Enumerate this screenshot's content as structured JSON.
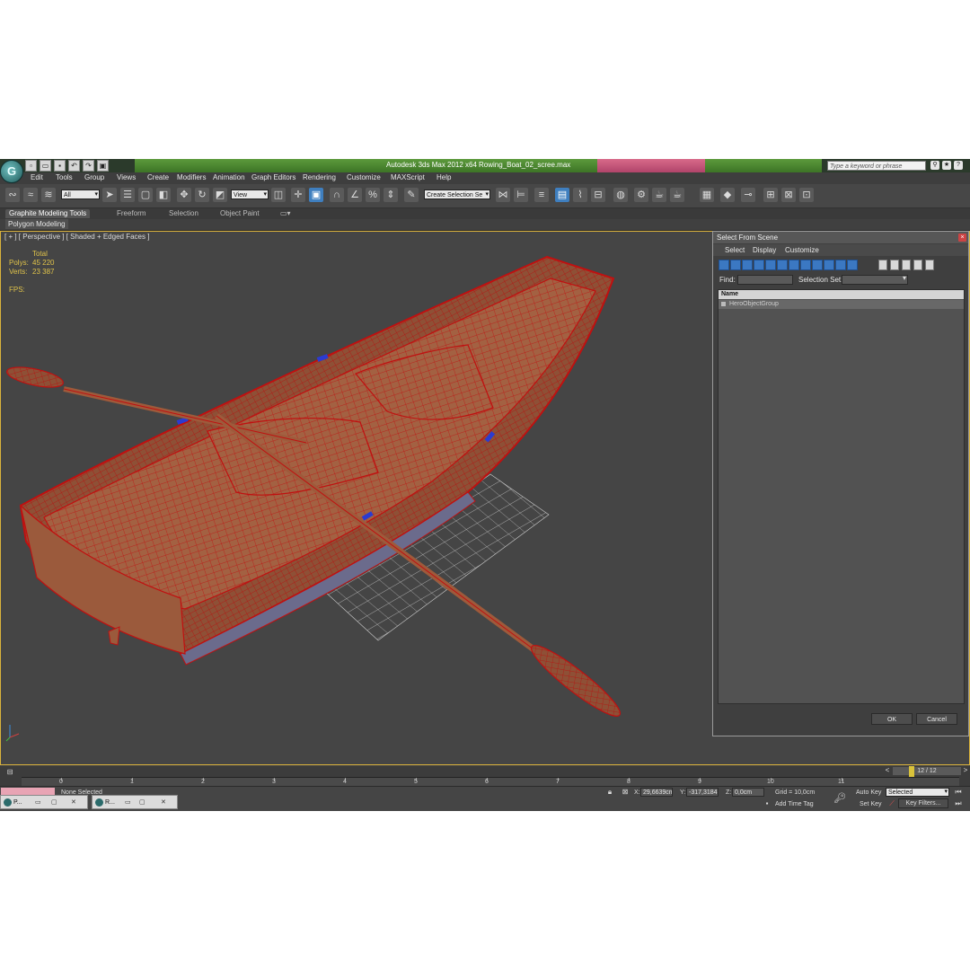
{
  "title": {
    "app": "Autodesk 3ds Max  2012 x64",
    "file": "Rowing_Boat_02_scree.max",
    "search_placeholder": "Type a keyword or phrase"
  },
  "menu": [
    "Edit",
    "Tools",
    "Group",
    "Views",
    "Create",
    "Modifiers",
    "Animation",
    "Graph Editors",
    "Rendering",
    "Customize",
    "MAXScript",
    "Help"
  ],
  "toolbar": {
    "selection_filter": "All",
    "reference_coord": "View",
    "named_selection": "Create Selection Se"
  },
  "ribbon": {
    "tabs": [
      "Graphite Modeling Tools",
      "Freeform",
      "Selection",
      "Object Paint"
    ],
    "panel_label": "Polygon Modeling"
  },
  "viewport": {
    "label": "[ + ] [ Perspective ] [ Shaded + Edged Faces ]",
    "stats_header": "Total",
    "polys_label": "Polys:",
    "polys_value": "45 220",
    "verts_label": "Verts:",
    "verts_value": "23 387",
    "fps_label": "FPS:"
  },
  "dialog": {
    "title": "Select From Scene",
    "menu": [
      "Select",
      "Display",
      "Customize"
    ],
    "find_label": "Find:",
    "selection_set_label": "Selection Set:",
    "column_name": "Name",
    "items": [
      "HeroObjectGroup"
    ],
    "ok": "OK",
    "cancel": "Cancel"
  },
  "timeline": {
    "frame_counter": "12 / 12",
    "ticks": [
      "0",
      "1",
      "2",
      "3",
      "4",
      "5",
      "6",
      "7",
      "8",
      "9",
      "10",
      "11"
    ]
  },
  "status": {
    "selection": "None Selected",
    "x_label": "X:",
    "x_value": "29,6639cm",
    "y_label": "Y:",
    "y_value": "-317,3184",
    "z_label": "Z:",
    "z_value": "0,0cm",
    "grid": "Grid = 10,0cm",
    "add_time_tag": "Add Time Tag",
    "auto_key": "Auto Key",
    "set_key": "Set Key",
    "key_mode": "Selected",
    "key_filters": "Key Filters..."
  },
  "taskbar": [
    "P...",
    "R..."
  ],
  "colors": {
    "wireframe": "#c01010",
    "wood": "#a0613f",
    "viewport_bg": "#454545",
    "title_green": "#4f8a33",
    "accent_blue": "#3b78c2"
  }
}
